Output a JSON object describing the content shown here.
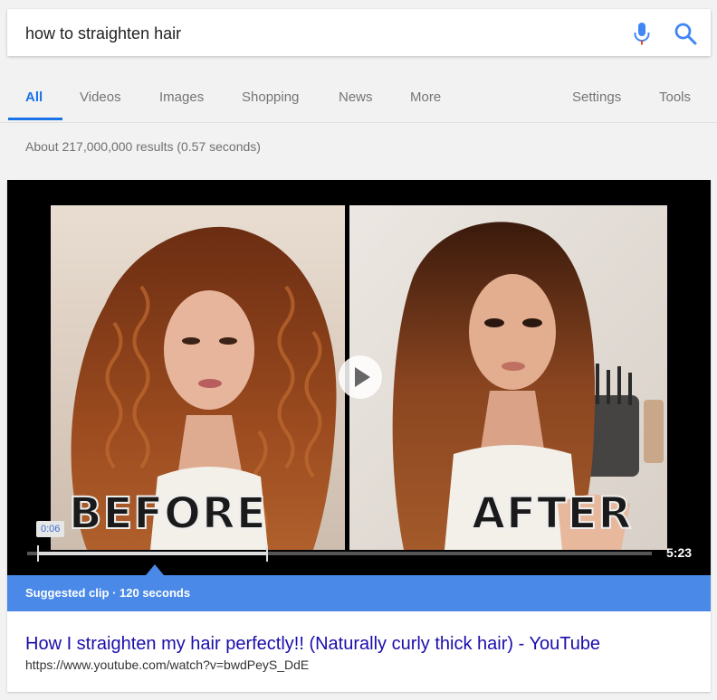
{
  "search": {
    "query": "how to straighten hair",
    "mic_icon": "microphone-icon",
    "search_icon": "magnifier-icon",
    "colors": {
      "mic_blue": "#4285f4",
      "mic_red": "#ea4335",
      "search_blue": "#4285f4"
    }
  },
  "tabs": {
    "items": [
      {
        "label": "All",
        "active": true
      },
      {
        "label": "Videos"
      },
      {
        "label": "Images"
      },
      {
        "label": "Shopping"
      },
      {
        "label": "News"
      },
      {
        "label": "More"
      }
    ],
    "settings": "Settings",
    "tools": "Tools",
    "accent": "#1a73e8"
  },
  "stats": "About 217,000,000 results (0.57 seconds)",
  "video": {
    "before_label": "BEFORE",
    "after_label": "AFTER",
    "current_time": "0:06",
    "duration": "5:23",
    "suggested_clip": "Suggested clip · 120 seconds",
    "clip_bar_color": "#4a89e8",
    "play_icon": "play-icon"
  },
  "result": {
    "title": "How I straighten my hair perfectly!! (Naturally curly thick hair) - YouTube",
    "url": "https://www.youtube.com/watch?v=bwdPeyS_DdE",
    "title_color": "#1a0dab"
  }
}
